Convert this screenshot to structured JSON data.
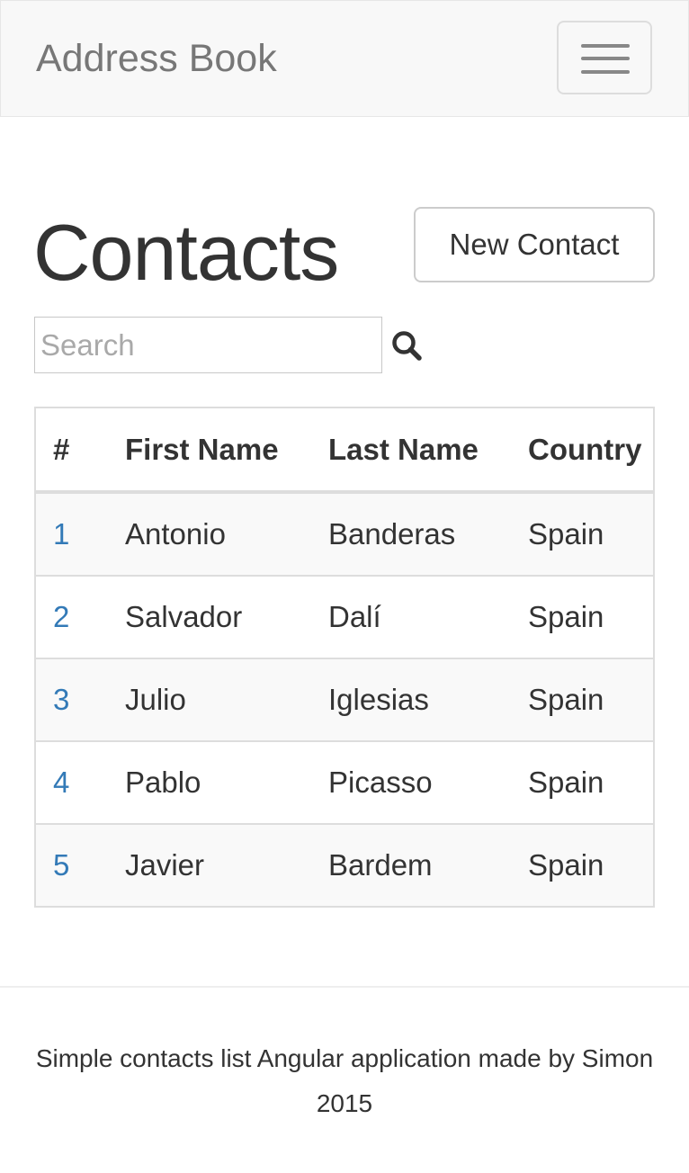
{
  "navbar": {
    "brand": "Address Book",
    "toggle_icon": "hamburger-menu-icon"
  },
  "main": {
    "title": "Contacts",
    "new_contact_label": "New Contact",
    "search": {
      "placeholder": "Search",
      "value": "",
      "icon": "search-icon"
    }
  },
  "table": {
    "headers": [
      "#",
      "First Name",
      "Last Name",
      "Country"
    ],
    "rows": [
      {
        "id": "1",
        "first": "Antonio",
        "last": "Banderas",
        "country": "Spain"
      },
      {
        "id": "2",
        "first": "Salvador",
        "last": "Dalí",
        "country": "Spain"
      },
      {
        "id": "3",
        "first": "Julio",
        "last": "Iglesias",
        "country": "Spain"
      },
      {
        "id": "4",
        "first": "Pablo",
        "last": "Picasso",
        "country": "Spain"
      },
      {
        "id": "5",
        "first": "Javier",
        "last": "Bardem",
        "country": "Spain"
      }
    ]
  },
  "footer": {
    "line1": "Simple contacts list Angular application made by Simon",
    "line2": "2015"
  },
  "colors": {
    "link": "#337ab7",
    "navbar_bg": "#f8f8f8",
    "text": "#333333"
  }
}
